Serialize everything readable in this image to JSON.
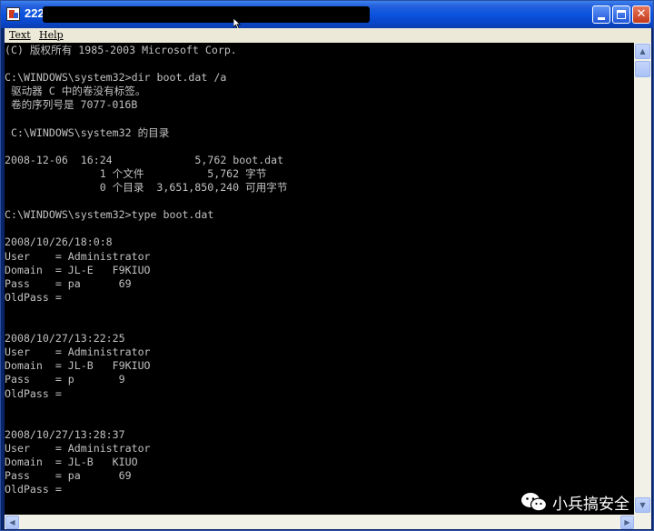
{
  "window": {
    "title": "222"
  },
  "menu": {
    "items": [
      "Text",
      "Help"
    ]
  },
  "console": {
    "lines": [
      "(C) 版权所有 1985-2003 Microsoft Corp.",
      "",
      "C:\\WINDOWS\\system32>dir boot.dat /a",
      " 驱动器 C 中的卷没有标签。",
      " 卷的序列号是 7077-016B",
      "",
      " C:\\WINDOWS\\system32 的目录",
      "",
      "2008-12-06  16:24             5,762 boot.dat",
      "               1 个文件          5,762 字节",
      "               0 个目录  3,651,850,240 可用字节",
      "",
      "C:\\WINDOWS\\system32>type boot.dat",
      "",
      "2008/10/26/18:0:8",
      "User    = Administrator",
      "Domain  = JL-E   F9KIUO",
      "Pass    = pa      69",
      "OldPass =",
      "",
      "",
      "2008/10/27/13:22:25",
      "User    = Administrator",
      "Domain  = JL-B   F9KIUO",
      "Pass    = p       9",
      "OldPass =",
      "",
      "",
      "2008/10/27/13:28:37",
      "User    = Administrator",
      "Domain  = JL-B   KIUO",
      "Pass    = pa      69",
      "OldPass ="
    ]
  },
  "watermark": {
    "text": "小兵搞安全"
  },
  "colors": {
    "console_bg": "#000000",
    "console_fg": "#c0c0c0",
    "titlebar": "#0a53df",
    "menubar": "#ece9d8"
  }
}
